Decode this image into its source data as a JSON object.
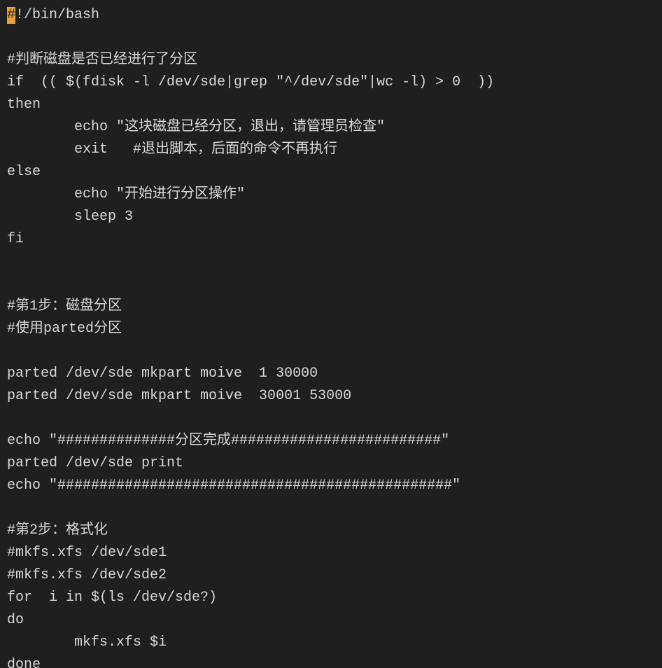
{
  "code": {
    "cursor_char": "#",
    "line01_rest": "!/bin/bash",
    "line02": "",
    "line03": "#判断磁盘是否已经进行了分区",
    "line04": "if  (( $(fdisk -l /dev/sde|grep \"^/dev/sde\"|wc -l) > 0  ))",
    "line05": "then",
    "line06": "        echo \"这块磁盘已经分区，退出，请管理员检查\"",
    "line07": "        exit   #退出脚本，后面的命令不再执行",
    "line08": "else",
    "line09": "        echo \"开始进行分区操作\"",
    "line10": "        sleep 3",
    "line11": "fi",
    "line12": "",
    "line13": "",
    "line14": "#第1步：磁盘分区",
    "line15": "#使用parted分区",
    "line16": "",
    "line17": "parted /dev/sde mkpart moive  1 30000",
    "line18": "parted /dev/sde mkpart moive  30001 53000",
    "line19": "",
    "line20": "echo \"##############分区完成#########################\"",
    "line21": "parted /dev/sde print",
    "line22": "echo \"###############################################\"",
    "line23": "",
    "line24": "#第2步：格式化",
    "line25": "#mkfs.xfs /dev/sde1",
    "line26": "#mkfs.xfs /dev/sde2",
    "line27": "for  i in $(ls /dev/sde?)",
    "line28": "do",
    "line29": "        mkfs.xfs $i",
    "line30": "done"
  }
}
